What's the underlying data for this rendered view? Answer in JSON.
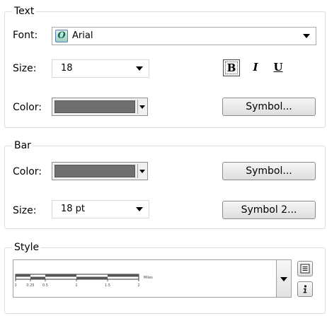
{
  "text_group": {
    "title": "Text",
    "font_label": "Font:",
    "font_value": "Arial",
    "font_icon": "truetype-font-icon",
    "size_label": "Size:",
    "size_value": "18",
    "color_label": "Color:",
    "color_value": "#6f6f6f",
    "symbol_button": "Symbol...",
    "bold_label": "B",
    "italic_label": "I",
    "underline_label": "U"
  },
  "bar_group": {
    "title": "Bar",
    "color_label": "Color:",
    "color_value": "#6f6f6f",
    "symbol_button": "Symbol...",
    "size_label": "Size:",
    "size_value": "18 pt",
    "symbol2_button": "Symbol 2..."
  },
  "style_group": {
    "title": "Style",
    "scale_ticks": [
      "0",
      "0.25",
      "0.5",
      "1",
      "1.5",
      "2"
    ],
    "scale_units": "Miles",
    "properties_icon": "properties-icon",
    "info_icon": "info-icon"
  }
}
